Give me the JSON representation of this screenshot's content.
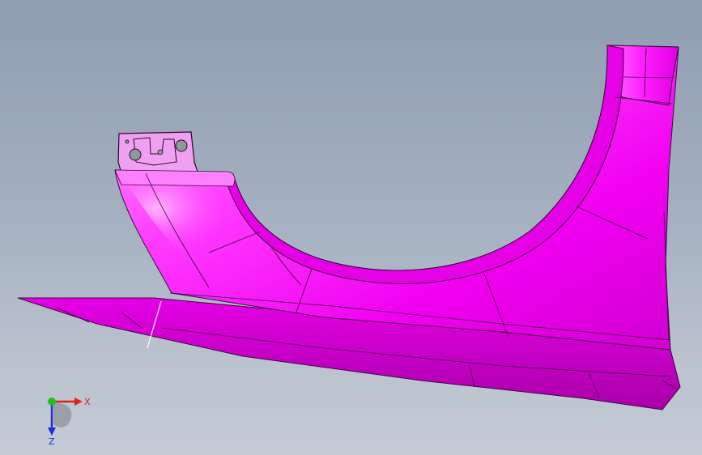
{
  "viewport": {
    "background_top": "#8f9db1",
    "background_bottom": "#c4cbd5"
  },
  "model": {
    "part": "fender",
    "color": "#ff00ff",
    "shade_color": "#c800c8",
    "highlight_color": "#ffb4ff",
    "edge_color": "#2a0a2a"
  },
  "triad": {
    "x_label": "X",
    "z_label": "Z",
    "x_color": "#e02020",
    "y_color": "#20c020",
    "z_color": "#2030d0"
  }
}
